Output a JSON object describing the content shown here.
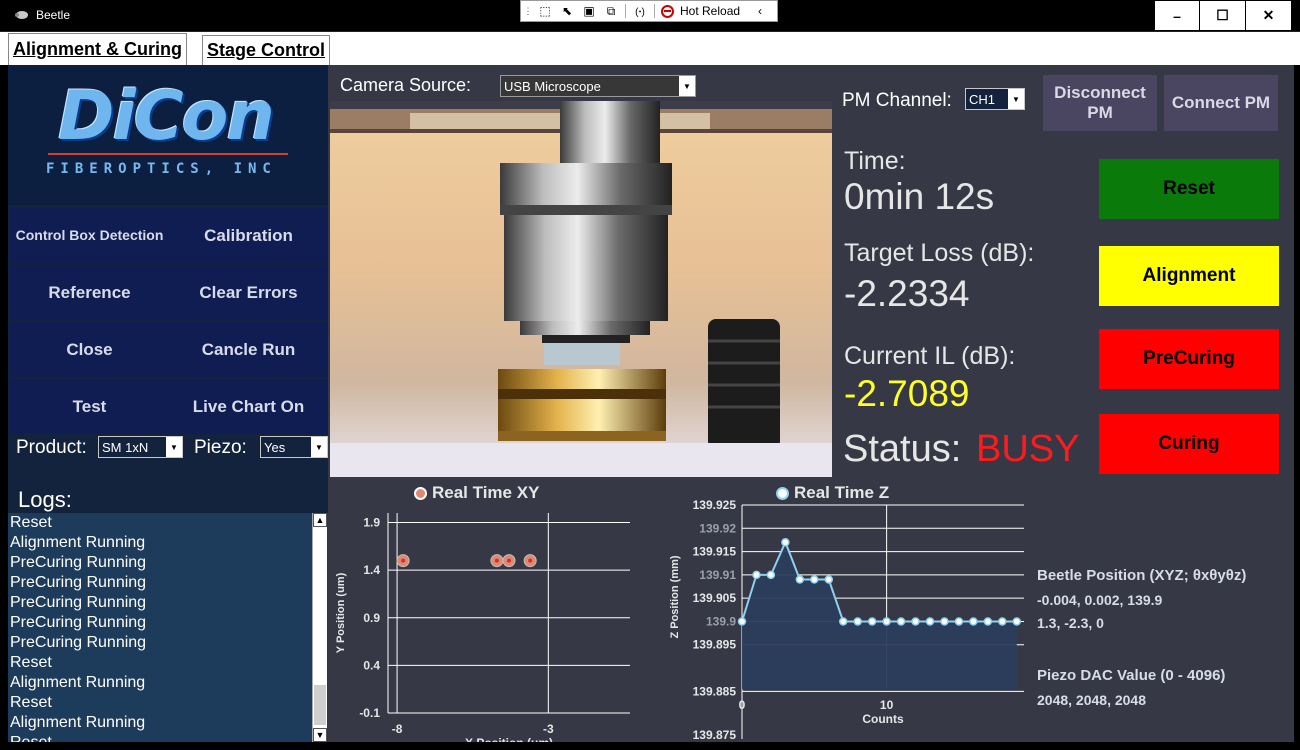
{
  "window": {
    "title": "Beetle",
    "toolbar": {
      "hot_reload": "Hot Reload"
    },
    "controls": {
      "minimize": "–",
      "maximize": "☐",
      "close": "✕"
    }
  },
  "tabs": [
    {
      "label": "Alignment & Curing",
      "active": true
    },
    {
      "label": "Stage Control",
      "active": false
    }
  ],
  "logo": {
    "brand": "DiCon",
    "subtitle": "FIBEROPTICS, INC"
  },
  "left_buttons": {
    "control_box": "Control Box Detection",
    "calibration": "Calibration",
    "reference": "Reference",
    "clear_errors": "Clear Errors",
    "close": "Close",
    "cancel_run": "Cancle Run",
    "test": "Test",
    "live_chart": "Live Chart On"
  },
  "product": {
    "label": "Product:",
    "value": "SM 1xN"
  },
  "piezo": {
    "label": "Piezo:",
    "value": "Yes"
  },
  "logs": {
    "label": "Logs:",
    "lines": [
      "Reset",
      "Alignment Running",
      "PreCuring Running",
      "PreCuring Running",
      "PreCuring Running",
      "PreCuring Running",
      "PreCuring Running",
      "Reset",
      "Alignment Running",
      "Reset",
      "Alignment Running",
      "Reset"
    ]
  },
  "camera": {
    "label": "Camera Source:",
    "value": "USB Microscope"
  },
  "pm": {
    "label": "PM Channel:",
    "channel": "CH1",
    "disconnect": "Disconnect PM",
    "connect": "Connect PM"
  },
  "stats": {
    "time_label": "Time:",
    "time_value": "0min 12s",
    "target_label": "Target Loss (dB):",
    "target_value": "-2.2334",
    "current_label": "Current IL (dB):",
    "current_value": "-2.7089",
    "status_label": "Status:",
    "status_value": "BUSY"
  },
  "state_buttons": {
    "reset": {
      "label": "Reset",
      "color": "#0a7a0a"
    },
    "alignment": {
      "label": "Alignment",
      "color": "#ffff00"
    },
    "precuring": {
      "label": "PreCuring",
      "color": "#ff0000"
    },
    "curing": {
      "label": "Curing",
      "color": "#ff0000"
    }
  },
  "info": {
    "position_title": "Beetle Position (XYZ; θxθyθz)",
    "position_xyz": "-0.004, 0.002, 139.9",
    "position_theta": "1.3, -2.3, 0",
    "dac_title": "Piezo DAC Value (0 - 4096)",
    "dac_values": "2048, 2048, 2048"
  },
  "chart_data": [
    {
      "type": "scatter",
      "legend": "Real Time XY",
      "xlabel": "X Position (um)",
      "ylabel": "Y Position (um)",
      "x_ticks": [
        "-8",
        "-3"
      ],
      "y_ticks": [
        "1.9",
        "1.4",
        "0.9",
        "0.4",
        "-0.1"
      ],
      "xlim": [
        -8.3,
        -0.3
      ],
      "ylim": [
        -0.1,
        2.0
      ],
      "x": [
        -7.8,
        -4.7,
        -4.3,
        -3.6
      ],
      "y": [
        1.5,
        1.5,
        1.5,
        1.5
      ],
      "color": "#e08870"
    },
    {
      "type": "line",
      "legend": "Real Time Z",
      "xlabel": "Counts",
      "ylabel": "Z Position (mm)",
      "x_ticks": [
        "0",
        "10"
      ],
      "y_ticks": [
        "139.925",
        "139.92",
        "139.915",
        "139.91",
        "139.905",
        "139.9",
        "139.895",
        "139.885",
        "139.875"
      ],
      "xlim": [
        0,
        19.5
      ],
      "ylim": [
        139.8855,
        139.925
      ],
      "x": [
        0,
        1,
        2,
        3,
        4,
        5,
        6,
        7,
        8,
        9,
        10,
        11,
        12,
        13,
        14,
        15,
        16,
        17,
        18,
        19
      ],
      "y": [
        139.9,
        139.91,
        139.91,
        139.917,
        139.909,
        139.909,
        139.909,
        139.9,
        139.9,
        139.9,
        139.9,
        139.9,
        139.9,
        139.9,
        139.9,
        139.9,
        139.9,
        139.9,
        139.9,
        139.9
      ],
      "color": "#8fd0f0"
    }
  ]
}
